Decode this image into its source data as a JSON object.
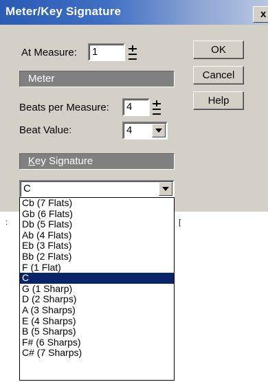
{
  "window": {
    "title": "Meter/Key Signature",
    "close": "x"
  },
  "measure": {
    "label": "At Measure:",
    "value": "1"
  },
  "meter": {
    "heading": "Meter",
    "beats_label": "Beats per Measure:",
    "beats_value": "4",
    "beat_value_label": "Beat Value:",
    "beat_value": "4"
  },
  "key": {
    "heading_underlined": "K",
    "heading_rest": "ey Signature",
    "selected": "C",
    "options": [
      "Cb (7 Flats)",
      "Gb (6 Flats)",
      "Db (5 Flats)",
      "Ab (4 Flats)",
      "Eb (3 Flats)",
      "Bb (2 Flats)",
      "F (1 Flat)",
      "C",
      "G (1 Sharp)",
      "D (2 Sharps)",
      "A (3 Sharps)",
      "E (4 Sharps)",
      "B (5 Sharps)",
      "F# (6 Sharps)",
      "C# (7 Sharps)"
    ],
    "highlighted_index": 7
  },
  "buttons": {
    "ok": "OK",
    "cancel": "Cancel",
    "help": "Help"
  },
  "colors": {
    "title_bar": "#2a5bb5",
    "dialog_bg": "#d4d0c8",
    "selection": "#0a246a"
  }
}
